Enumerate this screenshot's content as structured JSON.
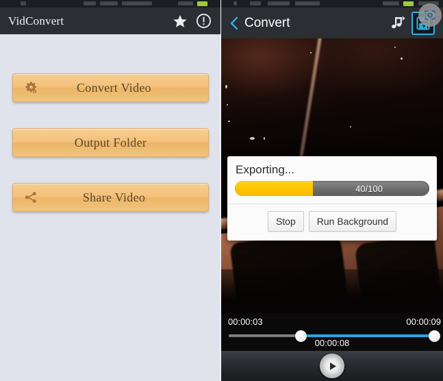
{
  "left_app": {
    "title": "VidConvert",
    "header_icons": [
      {
        "name": "star-icon",
        "label": "★"
      },
      {
        "name": "info-exclamation-icon",
        "label": "!"
      }
    ],
    "buttons": [
      {
        "label": "Convert Video",
        "icon": "gear-icon"
      },
      {
        "label": "Output Folder",
        "icon": "none"
      },
      {
        "label": "Share Video",
        "icon": "share-icon"
      }
    ],
    "background_color": "#e0e3eb",
    "button_color": "#f3c079",
    "header_color": "#2b2e33"
  },
  "right_app": {
    "back_label": "Convert",
    "back_icon": "chevron-left-icon",
    "header_icons": [
      {
        "name": "extract-audio-icon",
        "label": "music-note-arrow"
      },
      {
        "name": "save-export-icon",
        "label": "floppy-arrow"
      }
    ],
    "accent_color": "#2bb3e8",
    "header_color": "#2b2e33"
  },
  "dialog": {
    "title": "Exporting...",
    "progress": {
      "text": "40/100",
      "value": 40,
      "max": 100,
      "percent": 40,
      "fill_color": "#ffc400",
      "track_color": "#6e6e6e"
    },
    "buttons": [
      {
        "label": "Stop",
        "name": "stop-button"
      },
      {
        "label": "Run Background",
        "name": "run-background-button"
      }
    ]
  },
  "timeline": {
    "start_time": "00:00:03",
    "end_time": "00:00:09",
    "current_time": "00:00:08",
    "handle_start_percent": 35,
    "handle_end_percent": 100,
    "range_color": "#2aa3e4"
  },
  "player": {
    "play_icon": "play-icon"
  }
}
